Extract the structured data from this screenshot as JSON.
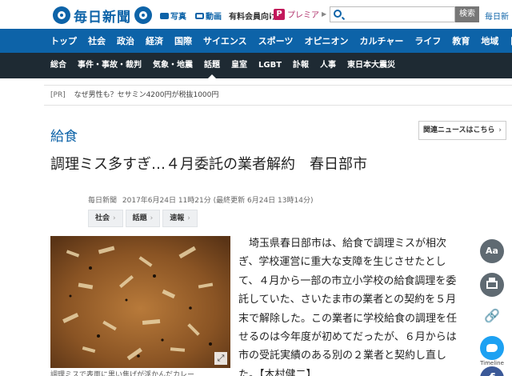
{
  "header": {
    "logo_text": "毎日新聞",
    "photo_label": "写真",
    "video_label": "動画",
    "paid_label": "有料会員向け",
    "premier_badge": "P",
    "premier_label": "プレミア",
    "search_placeholder": "",
    "search_button": "検索",
    "extra_link": "毎日新"
  },
  "main_nav": [
    "トップ",
    "社会",
    "政治",
    "経済",
    "国際",
    "サイエンス",
    "スポーツ",
    "オピニオン",
    "カルチャー",
    "ライフ",
    "教育",
    "地域",
    "日"
  ],
  "sub_nav": {
    "items": [
      "総合",
      "事件・事故・裁判",
      "気象・地震",
      "話題",
      "皇室",
      "LGBT",
      "訃報",
      "人事",
      "東日本大震災"
    ],
    "active": "話題"
  },
  "pr": {
    "tag": "[PR]",
    "text": "なぜ男性も？セサミン4200円が税抜1000円"
  },
  "article": {
    "topic": "給食",
    "related_label": "関連ニュースはこちら",
    "headline": "調理ミス多すぎ…４月委託の業者解約　春日部市",
    "source": "毎日新聞",
    "published": "2017年6月24日 11時21分",
    "updated": "(最終更新 6月24日 13時14分)",
    "tags": [
      "社会",
      "話題",
      "速報"
    ],
    "photo_caption": "調理ミスで表面に黒い焦げが浮かんだカレー",
    "body": "埼玉県春日部市は、給食で調理ミスが相次ぎ、学校運営に重大な支障を生じさせたとして、４月から一部の市立小学校の給食調理を委託していた、さいたま市の業者との契約を５月末で解除した。この業者に学校給食の調理を任せるのは今年度が初めてだったが、６月からは市の受託実績のある別の２業者と契約し直した。",
    "byline": "【木村健二】"
  },
  "share": {
    "font_label": "Aa",
    "timeline_label": "Timeline",
    "fb_label": "f"
  },
  "colors": {
    "brand": "#0d63a8",
    "subnav_bg": "#1e2a33",
    "twitter": "#1da1f2",
    "facebook": "#3b5998"
  }
}
